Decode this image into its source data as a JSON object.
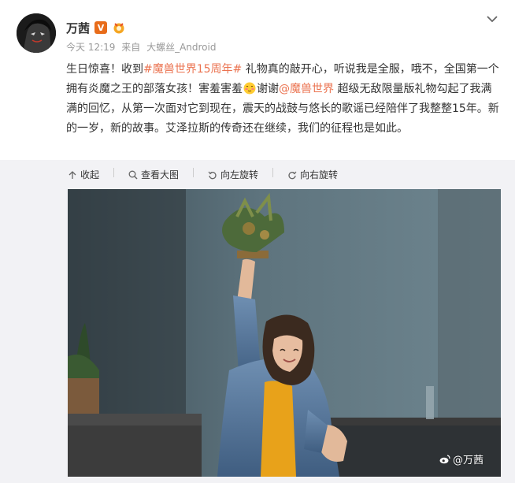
{
  "post": {
    "username": "万茜",
    "verified_badge": "V",
    "time": "今天 12:19",
    "from_label": "来自",
    "source": "大螺丝_Android",
    "text": {
      "p1": "生日惊喜！收到",
      "hashtag": "#魔兽世界15周年#",
      "p2": " 礼物真的敲开心，听说我是全服，哦不，全国第一个拥有炎魔之王的部落女孩！害羞害羞",
      "p3": "谢谢",
      "mention": "@魔兽世界",
      "p4": " 超级无敌限量版礼物勾起了我满满的回忆，从第一次面对它到现在，震天的战鼓与悠长的歌谣已经陪伴了我整整15年。新的一岁，新的故事。艾泽拉斯的传奇还在继续，我们的征程也是如此。"
    },
    "watermark": "@万茜"
  },
  "toolbar": {
    "collapse_label": "收起",
    "view_large_label": "查看大图",
    "rotate_left_label": "向左旋转",
    "rotate_right_label": "向右旋转"
  },
  "colors": {
    "link": "#eb7350",
    "meta": "#999999",
    "media_bg": "#f2f2f5",
    "badge": "#e86c1a"
  }
}
